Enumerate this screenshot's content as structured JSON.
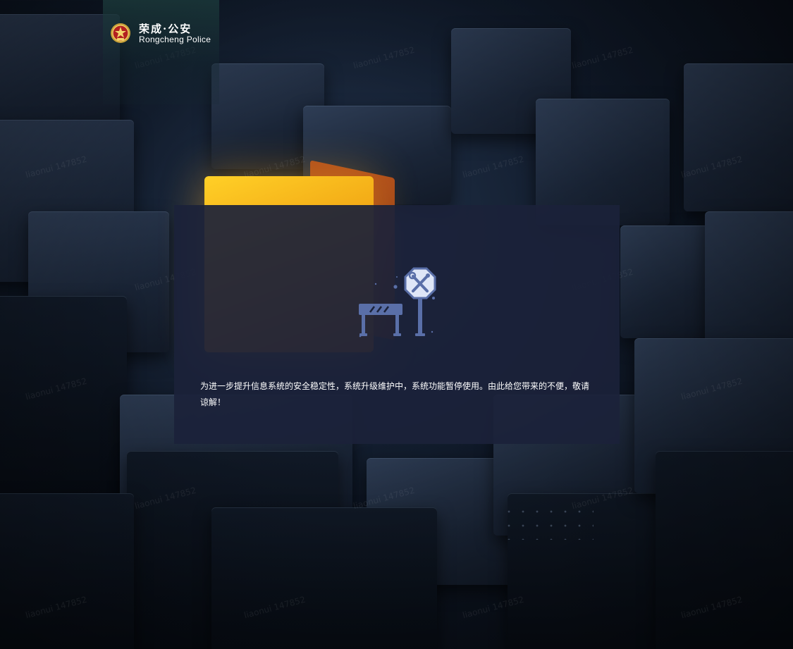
{
  "header": {
    "brand_cn": "荣成·公安",
    "brand_en": "Rongcheng Police",
    "emblem_icon": "police-emblem-icon"
  },
  "maintenance": {
    "illustration_icon": "maintenance-barrier-sign-icon",
    "message": "为进一步提升信息系统的安全稳定性，系统升级维护中，系统功能暂停使用。由此给您带来的不便，敬请谅解！"
  },
  "background": {
    "watermark_text": "liaonui 147852"
  },
  "colors": {
    "card_bg": "#1b223a",
    "icon_blue": "#5a6fa8",
    "accent_yellow": "#f5b31a",
    "text": "#ffffff"
  }
}
